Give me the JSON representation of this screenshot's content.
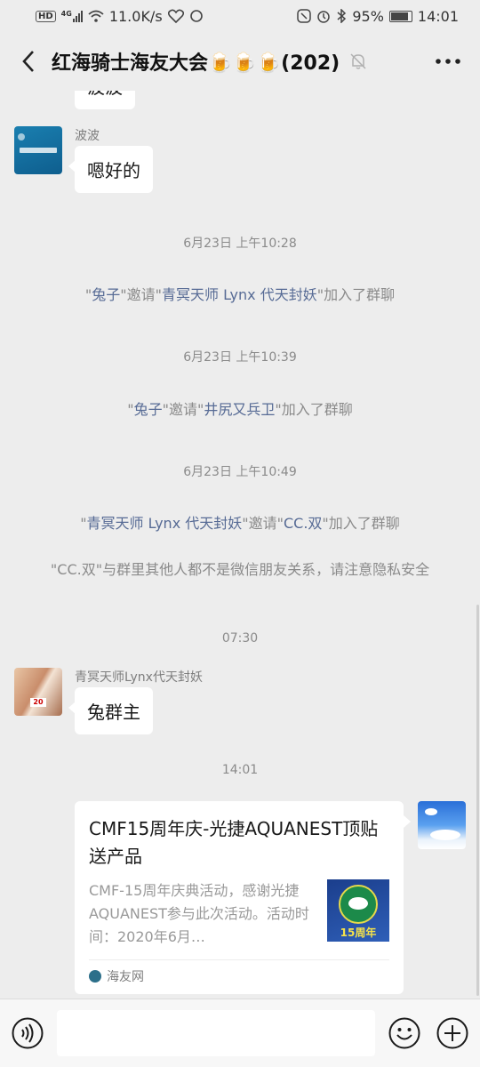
{
  "status": {
    "left_badge": "HD",
    "network_type": "4G",
    "speed": "11.0K/s",
    "battery": "95%",
    "time": "14:01"
  },
  "header": {
    "title": "红海骑士海友大会🍺🍺🍺(202)"
  },
  "messages": {
    "partial_text": "波波",
    "bobo_sender": "波波",
    "bobo_text": "嗯好的",
    "time1": "6月23日 上午10:28",
    "sys1": {
      "q1": "\"",
      "a": "兔子",
      "mid": "\"邀请\"",
      "b": "青冥天师 Lynx 代天封妖",
      "end": "\"加入了群聊"
    },
    "time2": "6月23日 上午10:39",
    "sys2": {
      "q1": "\"",
      "a": "兔子",
      "mid": "\"邀请\"",
      "b": "井尻又兵卫",
      "end": "\"加入了群聊"
    },
    "time3": "6月23日 上午10:49",
    "sys3": {
      "q1": "\"",
      "a": "青冥天师 Lynx 代天封妖",
      "mid": "\"邀请\"",
      "b": "CC.双",
      "end": "\"加入了群聊"
    },
    "sys4": "\"CC.双\"与群里其他人都不是微信朋友关系，请注意隐私安全",
    "time4": "07:30",
    "lynx_sender": "青冥天师Lynx代天封妖",
    "lynx_text": "兔群主",
    "time5": "14:01",
    "card": {
      "title": "CMF15周年庆-光捷AQUANEST顶贴送产品",
      "desc": "CMF-15周年庆典活动，感谢光捷AQUANEST参与此次活动。活动时间：2020年6月…",
      "thumb_text": "15周年",
      "source": "海友网"
    }
  },
  "icons": {
    "back": "back-arrow-icon",
    "mute": "bell-muted-icon",
    "more": "more-dots-icon",
    "voice": "voice-icon",
    "emoji": "emoji-icon",
    "add": "plus-icon"
  },
  "colors": {
    "background": "#ededed",
    "name_link": "#576b95",
    "bubble": "#ffffff"
  }
}
